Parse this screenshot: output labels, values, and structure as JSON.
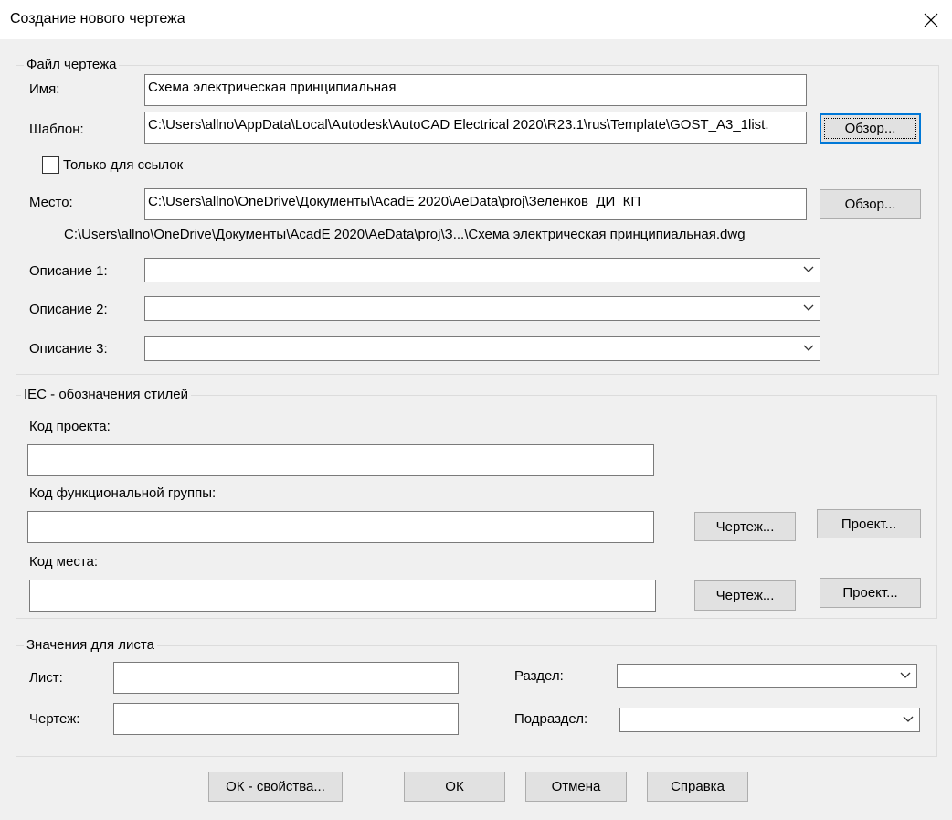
{
  "window": {
    "title": "Создание нового чертежа"
  },
  "file_group": {
    "legend": "Файл чертежа",
    "name_label": "Имя:",
    "name_value": "Схема электрическая принципиальная",
    "template_label": "Шаблон:",
    "template_value": "C:\\Users\\allno\\AppData\\Local\\Autodesk\\AutoCAD Electrical 2020\\R23.1\\rus\\Template\\GOST_A3_1list.",
    "browse_label": "Обзор...",
    "reference_only_label": "Только для ссылок",
    "reference_only_checked": false,
    "location_label": "Место:",
    "location_value": "C:\\Users\\allno\\OneDrive\\Документы\\AcadE 2020\\AeData\\proj\\Зеленков_ДИ_КП",
    "location_browse_label": "Обзор...",
    "full_path": "C:\\Users\\allno\\OneDrive\\Документы\\AcadE 2020\\AeData\\proj\\З...\\Схема электрическая принципиальная.dwg",
    "desc1_label": "Описание 1:",
    "desc1_value": "",
    "desc2_label": "Описание 2:",
    "desc2_value": "",
    "desc3_label": "Описание 3:",
    "desc3_value": ""
  },
  "iec_group": {
    "legend": "IEC - обозначения стилей",
    "project_code_label": "Код проекта:",
    "project_code_value": "",
    "func_group_label": "Код функциональной группы:",
    "func_group_value": "",
    "func_drawing_btn": "Чертеж...",
    "func_project_btn": "Проект...",
    "location_code_label": "Код места:",
    "location_code_value": "",
    "loc_drawing_btn": "Чертеж...",
    "loc_project_btn": "Проект..."
  },
  "sheet_group": {
    "legend": "Значения для листа",
    "sheet_label": "Лист:",
    "sheet_value": "",
    "drawing_label": "Чертеж:",
    "drawing_value": "",
    "section_label": "Раздел:",
    "section_value": "",
    "subsection_label": "Подраздел:",
    "subsection_value": ""
  },
  "footer": {
    "ok_props": "ОК - свойства...",
    "ok": "ОК",
    "cancel": "Отмена",
    "help": "Справка"
  },
  "colors": {
    "window_bg": "#f0f0f0",
    "titlebar_bg": "#ffffff",
    "focus_border": "#0078d7"
  }
}
